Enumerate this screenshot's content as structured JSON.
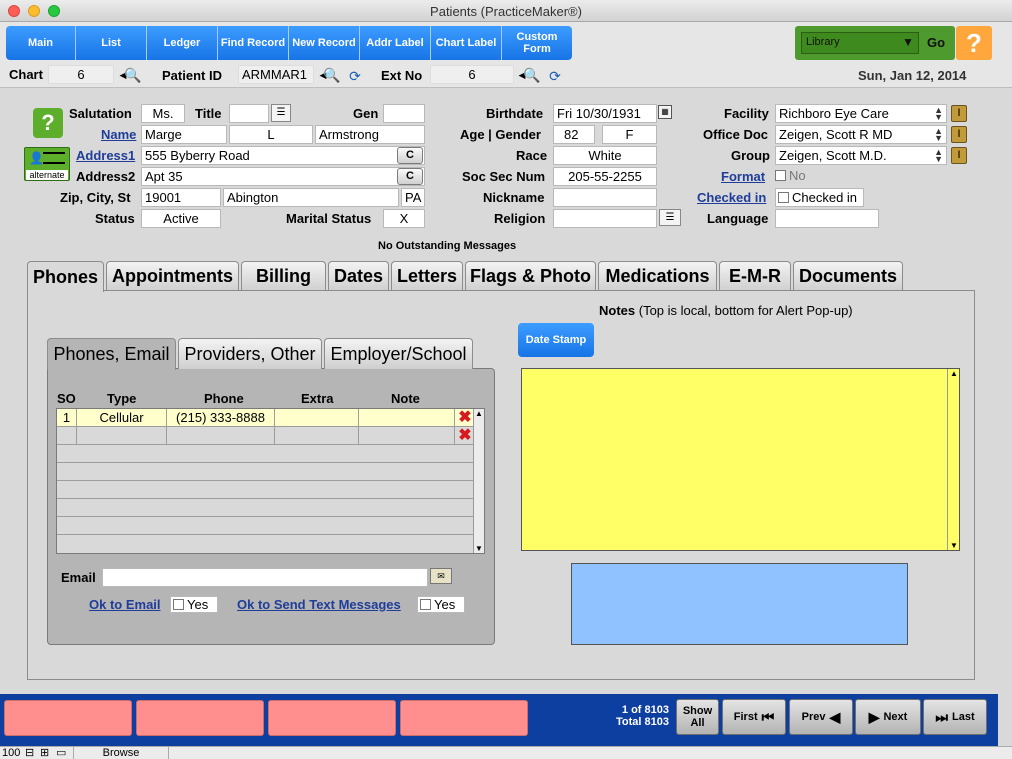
{
  "window": {
    "title": "Patients (PracticeMaker®)"
  },
  "toolbar": {
    "nav_buttons": [
      "Main",
      "List",
      "Ledger",
      "Find Record",
      "New Record",
      "Addr Label",
      "Chart Label",
      "Custom Form"
    ],
    "library_value": "Library",
    "go_label": "Go",
    "help_label": "?"
  },
  "infobar": {
    "chart_label": "Chart",
    "chart_value": "6",
    "patient_id_label": "Patient ID",
    "patient_id_value": "ARMMAR1",
    "ext_no_label": "Ext No",
    "ext_no_value": "6",
    "date": "Sun, Jan 12, 2014"
  },
  "demographics": {
    "salutation_label": "Salutation",
    "salutation": "Ms.",
    "title_label": "Title",
    "title": "",
    "gen_label": "Gen",
    "gen": "",
    "name_label": "Name",
    "first_name": "Marge",
    "middle": "L",
    "last_name": "Armstrong",
    "address1_label": "Address1",
    "address1": "555 Byberry Road",
    "address2_label": "Address2",
    "address2": "Apt 35",
    "c_label": "C",
    "zip_label": "Zip, City, St",
    "zip": "19001",
    "city": "Abington",
    "state": "PA",
    "status_label": "Status",
    "status": "Active",
    "marital_label": "Marital Status",
    "marital": "X",
    "alternate_label": "alternate",
    "birthdate_label": "Birthdate",
    "birthdate": "Fri 10/30/1931",
    "age_gender_label": "Age | Gender",
    "age": "82",
    "gender": "F",
    "race_label": "Race",
    "race": "White",
    "ssn_label": "Soc Sec Num",
    "ssn": "205-55-2255",
    "nickname_label": "Nickname",
    "nickname": "",
    "religion_label": "Religion",
    "religion": "",
    "facility_label": "Facility",
    "facility": "Richboro Eye Care",
    "office_doc_label": "Office Doc",
    "office_doc": "Zeigen, Scott R MD",
    "group_label": "Group",
    "group": "Zeigen, Scott  M.D.",
    "format_label": "Format",
    "format_value": "No",
    "checked_in_label": "Checked in",
    "checked_in_value": "Checked in",
    "language_label": "Language",
    "language": ""
  },
  "messages": "No Outstanding Messages",
  "tabs": [
    "Phones",
    "Appointments",
    "Billing",
    "Dates",
    "Letters",
    "Flags & Photo",
    "Medications",
    "E-M-R",
    "Documents"
  ],
  "subtabs": [
    "Phones, Email",
    "Providers, Other",
    "Employer/School"
  ],
  "phones": {
    "headers": [
      "SO",
      "Type",
      "Phone",
      "Extra",
      "Note"
    ],
    "rows": [
      {
        "so": "1",
        "type": "Cellular",
        "phone": "(215) 333-8888",
        "extra": "",
        "note": ""
      },
      {
        "so": "",
        "type": "",
        "phone": "",
        "extra": "",
        "note": ""
      }
    ],
    "email_label": "Email",
    "email": "",
    "ok_email_label": "Ok to Email",
    "ok_email_value": "Yes",
    "ok_text_label": "Ok to Send Text Messages",
    "ok_text_value": "Yes"
  },
  "notes": {
    "title": "Notes",
    "subtitle": "(Top is local, bottom for Alert Pop-up)",
    "date_stamp_label": "Date Stamp"
  },
  "footer": {
    "record_count": "1 of 8103",
    "total": "Total 8103",
    "show_all": "Show All",
    "first": "First",
    "prev": "Prev",
    "next": "Next",
    "last": "Last"
  },
  "statusbar": {
    "zoom": "100",
    "mode": "Browse"
  },
  "colors": {
    "nav_blue": "#1f7ef0",
    "notes_yellow": "#ffff66",
    "alert_blue": "#8fc2ff",
    "footer_blue": "#0c3fa0",
    "pink": "#ff8f8f"
  }
}
